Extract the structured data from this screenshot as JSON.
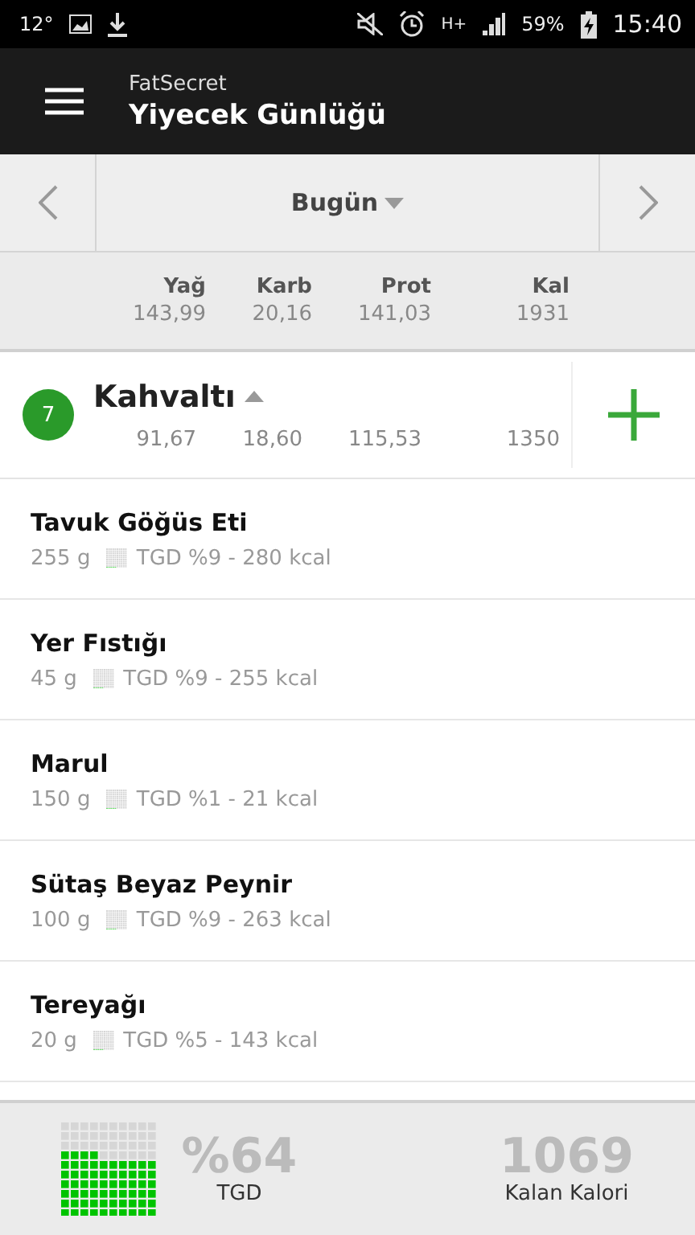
{
  "status_bar": {
    "temperature": "12°",
    "network": "H+",
    "battery": "59%",
    "time": "15:40"
  },
  "app_bar": {
    "app_name": "FatSecret",
    "title": "Yiyecek Günlüğü"
  },
  "date_nav": {
    "label": "Bugün"
  },
  "totals": [
    {
      "label": "Yağ",
      "value": "143,99"
    },
    {
      "label": "Karb",
      "value": "20,16"
    },
    {
      "label": "Prot",
      "value": "141,03"
    },
    {
      "label": "Kal",
      "value": "1931"
    }
  ],
  "meal": {
    "count": "7",
    "name": "Kahvaltı",
    "expanded": true,
    "values": [
      "91,67",
      "18,60",
      "115,53",
      "1350"
    ]
  },
  "items": [
    {
      "name": "Tavuk Göğüs Eti",
      "amount": "255 g",
      "detail": "TGD %9 - 280 kcal"
    },
    {
      "name": "Yer Fıstığı",
      "amount": "45 g",
      "detail": "TGD %9 - 255 kcal"
    },
    {
      "name": "Marul",
      "amount": "150 g",
      "detail": "TGD %1 - 21 kcal"
    },
    {
      "name": "Sütaş Beyaz Peynir",
      "amount": "100 g",
      "detail": "TGD %9 - 263 kcal"
    },
    {
      "name": "Tereyağı",
      "amount": "20 g",
      "detail": "TGD %5 - 143 kcal"
    }
  ],
  "footer": {
    "percent": "%64",
    "percent_label": "TGD",
    "remaining": "1069",
    "remaining_label": "Kalan Kalori"
  }
}
